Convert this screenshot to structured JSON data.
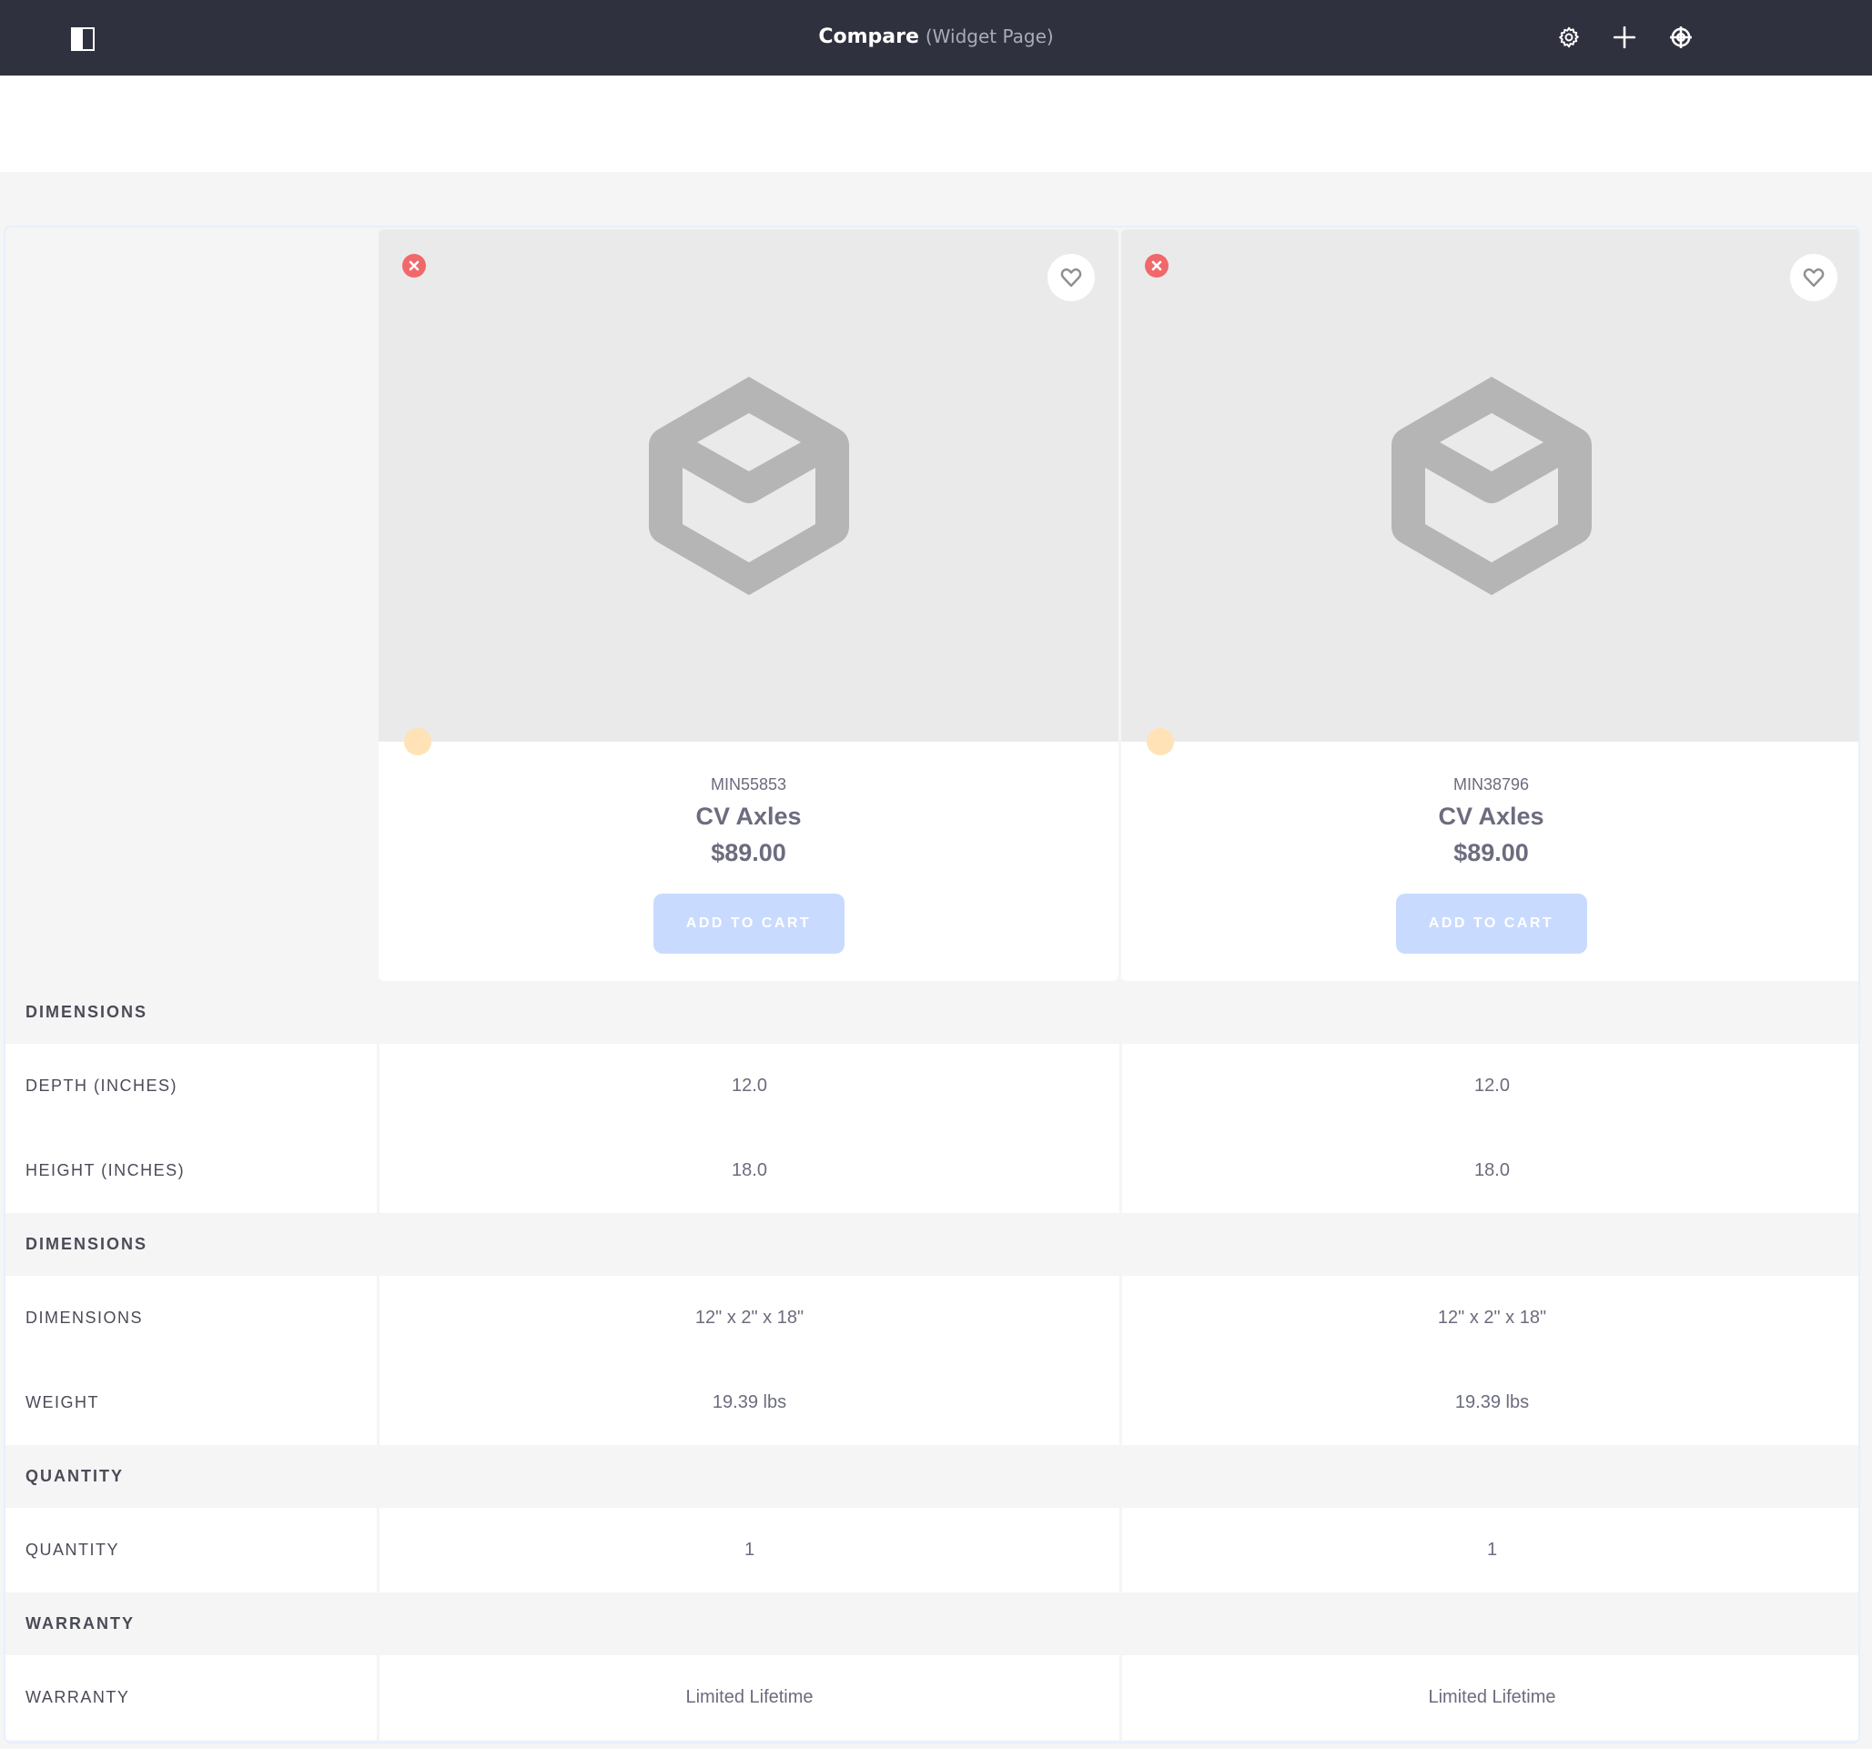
{
  "topbar": {
    "title": "Compare",
    "subtitle": "(Widget Page)",
    "icons": [
      "panel-toggle-icon",
      "gear-icon",
      "plus-icon",
      "target-icon"
    ]
  },
  "products": [
    {
      "sku": "MIN55853",
      "name": "CV Axles",
      "price": "$89.00",
      "add_to_cart": "ADD TO CART"
    },
    {
      "sku": "MIN38796",
      "name": "CV Axles",
      "price": "$89.00",
      "add_to_cart": "ADD TO CART"
    }
  ],
  "sections": [
    {
      "title": "DIMENSIONS",
      "rows": [
        {
          "label": "DEPTH (INCHES)",
          "values": [
            "12.0",
            "12.0"
          ]
        },
        {
          "label": "HEIGHT (INCHES)",
          "values": [
            "18.0",
            "18.0"
          ]
        }
      ]
    },
    {
      "title": "DIMENSIONS",
      "rows": [
        {
          "label": "DIMENSIONS",
          "values": [
            "12\" x 2\" x 18\"",
            "12\" x 2\" x 18\""
          ]
        },
        {
          "label": "WEIGHT",
          "values": [
            "19.39 lbs",
            "19.39 lbs"
          ]
        }
      ]
    },
    {
      "title": "QUANTITY",
      "rows": [
        {
          "label": "QUANTITY",
          "values": [
            "1",
            "1"
          ]
        }
      ]
    },
    {
      "title": "WARRANTY",
      "rows": [
        {
          "label": "WARRANTY",
          "values": [
            "Limited Lifetime",
            "Limited Lifetime"
          ]
        }
      ]
    }
  ],
  "colors": {
    "topbar_bg": "#30313f",
    "remove": "#f0686b",
    "add_to_cart_disabled": "#c9daff",
    "placeholder_icon": "#b5b5b5"
  }
}
